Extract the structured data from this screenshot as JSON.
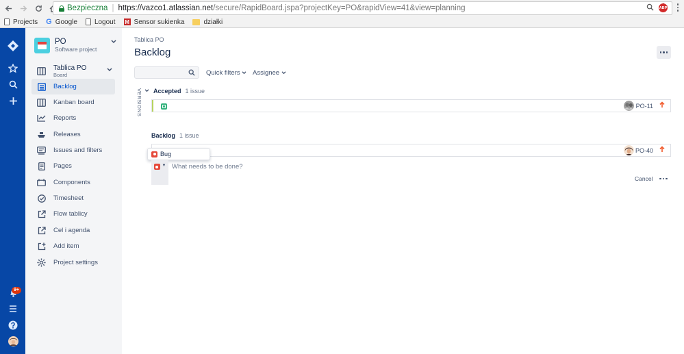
{
  "browser": {
    "secure_label": "Bezpieczna",
    "url_host": "https://vazco1.atlassian.net",
    "url_path": "/secure/RapidBoard.jspa?projectKey=PO&rapidView=41&view=planning",
    "extension_label": "ABP"
  },
  "bookmarks": [
    {
      "label": "Projects",
      "icon": "page-icon"
    },
    {
      "label": "Google",
      "icon": "google-icon"
    },
    {
      "label": "Logout",
      "icon": "page-icon"
    },
    {
      "label": "Sensor sukienka",
      "icon": "m-icon"
    },
    {
      "label": "działki",
      "icon": "folder-icon"
    }
  ],
  "global_nav": {
    "notifications_badge": "9+"
  },
  "project": {
    "name": "PO",
    "type": "Software project",
    "board_name": "Tablica PO",
    "board_sub": "Board"
  },
  "sidebar": {
    "items": [
      {
        "label": "Backlog",
        "icon": "backlog-icon",
        "active": true
      },
      {
        "label": "Kanban board",
        "icon": "board-icon"
      },
      {
        "label": "Reports",
        "icon": "reports-icon"
      },
      {
        "label": "Releases",
        "icon": "ship-icon"
      },
      {
        "label": "Issues and filters",
        "icon": "issues-icon"
      },
      {
        "label": "Pages",
        "icon": "pages-icon"
      },
      {
        "label": "Components",
        "icon": "components-icon"
      },
      {
        "label": "Timesheet",
        "icon": "check-circle-icon"
      },
      {
        "label": "Flow tablicy",
        "icon": "external-link-icon"
      },
      {
        "label": "Cel i agenda",
        "icon": "external-link-icon"
      },
      {
        "label": "Add item",
        "icon": "add-item-icon"
      },
      {
        "label": "Project settings",
        "icon": "gear-icon"
      }
    ]
  },
  "main": {
    "breadcrumb": "Tablica PO",
    "title": "Backlog",
    "quick_filters": "Quick filters",
    "assignee": "Assignee",
    "versions_label": "VERSIONS",
    "accepted": {
      "name": "Accepted",
      "count": "1 issue",
      "issue_key": "PO-11"
    },
    "backlog": {
      "name": "Backlog",
      "count": "1 issue",
      "issue_key": "PO-40"
    },
    "type_dropdown_option": "Bug",
    "create_placeholder": "What needs to be done?",
    "cancel_label": "Cancel"
  },
  "colors": {
    "global_nav": "#0747a6",
    "sidebar_bg": "#f4f5f7",
    "active_text": "#0052cc",
    "story": "#36b37e",
    "bug": "#e5493a",
    "priority_high": "#f15c2e"
  }
}
